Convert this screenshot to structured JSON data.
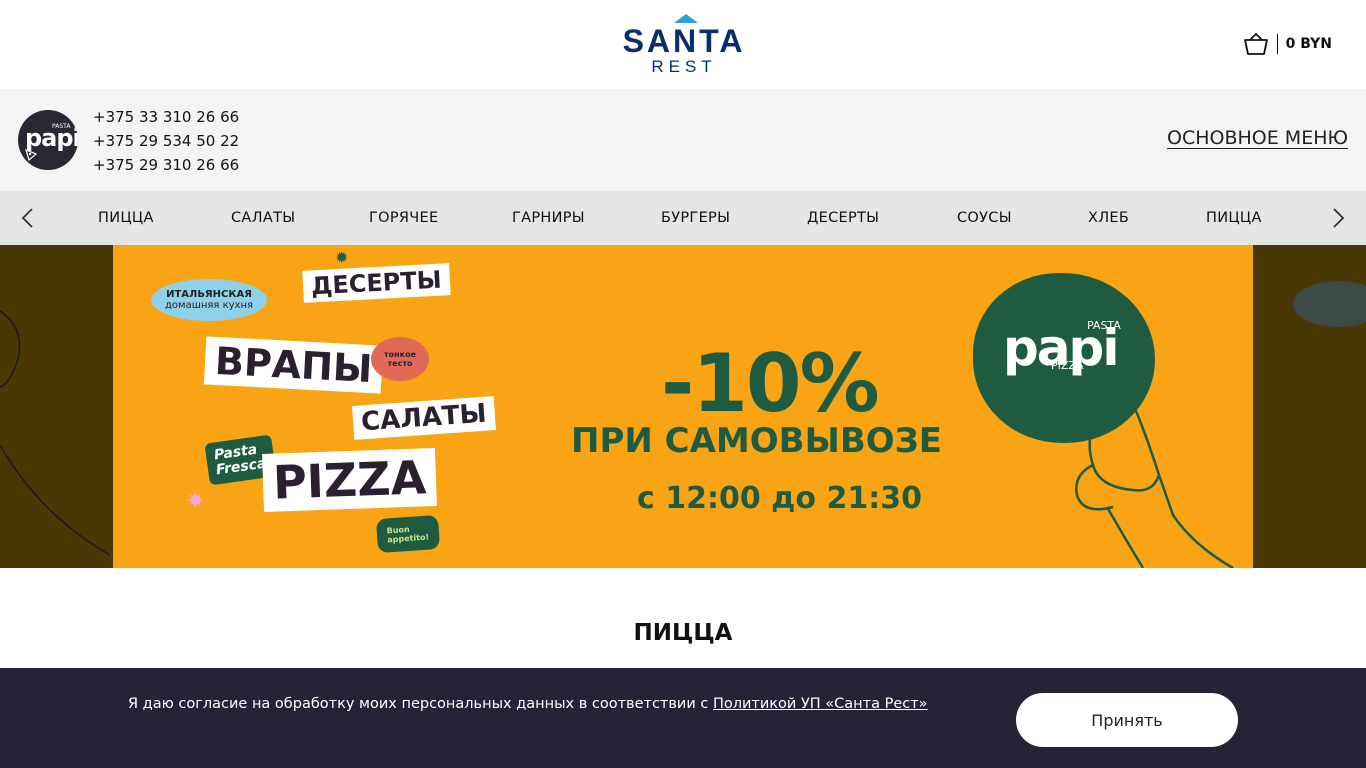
{
  "header": {
    "logo_main": "SANTA",
    "logo_sub": "REST",
    "cart_icon": "basket-icon",
    "cart_total": "0 BYN"
  },
  "restaurant": {
    "logo_text": "papi",
    "logo_small": "PASTA",
    "phones": [
      "+375 33 310 26 66",
      "+375 29 534 50 22",
      "+375 29 310 26 66"
    ],
    "main_menu_link": "ОСНОВНОЕ МЕНЮ"
  },
  "categories": {
    "prev_icon": "chevron-left-icon",
    "next_icon": "chevron-right-icon",
    "items": [
      "ПИЦЦА",
      "САЛАТЫ",
      "ГОРЯЧЕЕ",
      "ГАРНИРЫ",
      "БУРГЕРЫ",
      "ДЕСЕРТЫ",
      "СОУСЫ",
      "ХЛЕБ",
      "ПИЦЦА"
    ]
  },
  "banner": {
    "stickers": {
      "desserts": "ДЕСЕРТЫ",
      "italian_1": "ИТАЛЬЯНСКАЯ",
      "italian_2": "домашняя кухня",
      "wraps": "ВРАПЫ",
      "thin_1": "тонкое",
      "thin_2": "тесто",
      "salads": "САЛАТЫ",
      "pasta_1": "Pasta",
      "pasta_2": "Fresca",
      "pizza": "PIZZA",
      "buon_1": "Buon",
      "buon_2": "appetito!"
    },
    "discount": "-10%",
    "line": "ПРИ САМОВЫВОЗЕ",
    "time": "с 12:00 до 21:30",
    "badge_main": "papi",
    "badge_pasta": "PASTA",
    "badge_pizza": "PIZZA",
    "colors": {
      "background": "#f8a414",
      "green": "#1e5b40"
    }
  },
  "section": {
    "title": "ПИЦЦА"
  },
  "cookie": {
    "text": "Я даю согласие на обработку моих персональных данных в соответствии с ",
    "policy_link": "Политикой УП «Санта Рест»",
    "accept_button": "Принять"
  },
  "colors": {
    "brand_blue": "#0b2d6b",
    "cookie_bg": "#242436",
    "nav_bg": "#e5e5e5",
    "info_bg": "#f4f4f4"
  }
}
